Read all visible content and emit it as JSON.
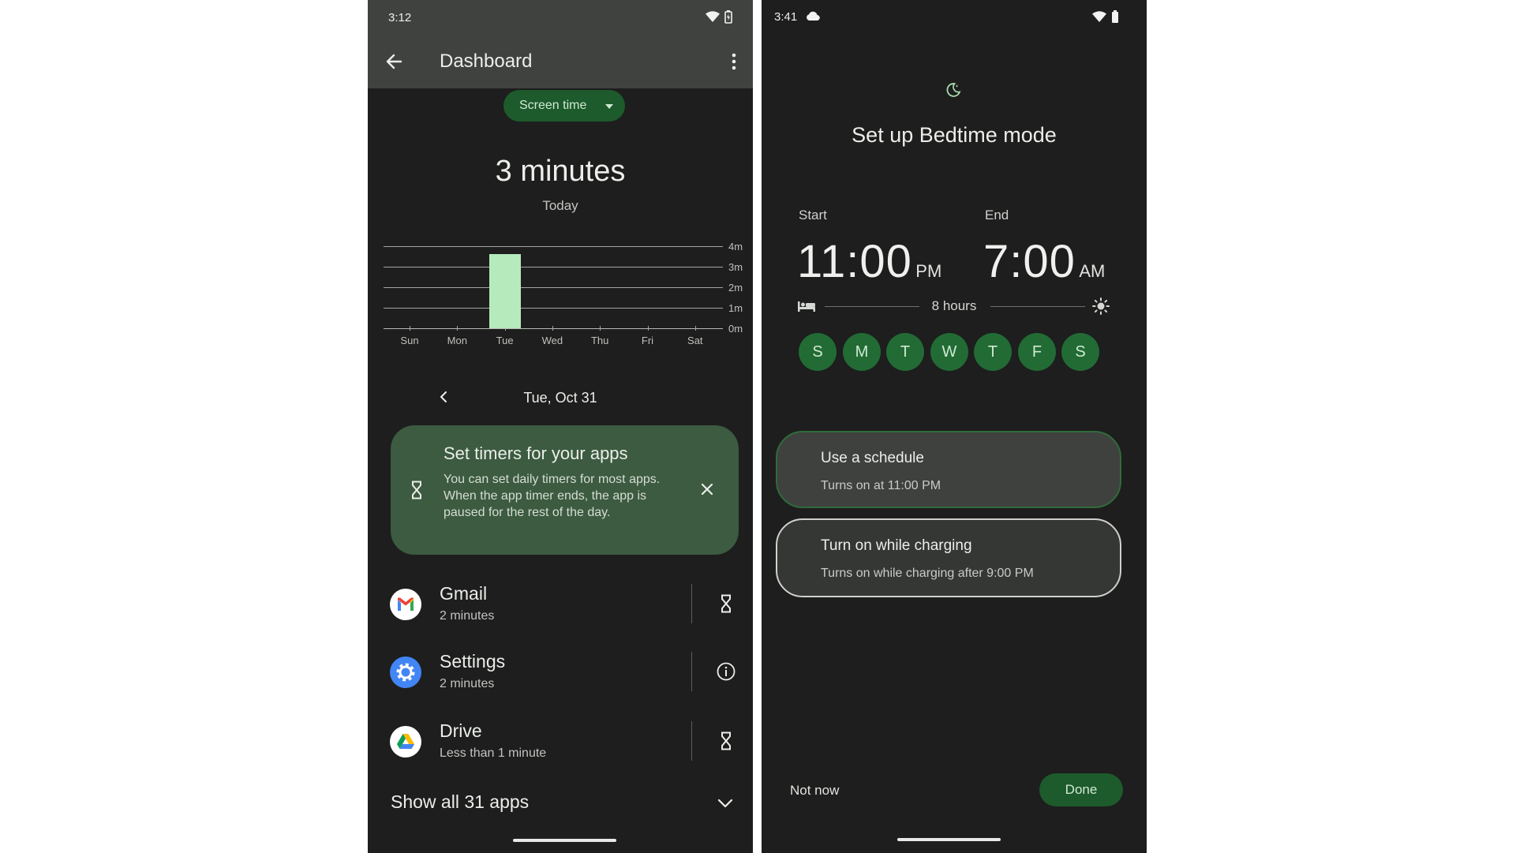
{
  "left": {
    "status": {
      "time": "3:12"
    },
    "appbar": {
      "title": "Dashboard"
    },
    "chip": {
      "label": "Screen time"
    },
    "summary": {
      "total": "3 minutes",
      "period": "Today"
    },
    "chart_data": {
      "type": "bar",
      "categories": [
        "Sun",
        "Mon",
        "Tue",
        "Wed",
        "Thu",
        "Fri",
        "Sat"
      ],
      "values": [
        0,
        0,
        3.6,
        0,
        0,
        0,
        0
      ],
      "y_ticks": [
        "4m",
        "3m",
        "2m",
        "1m",
        "0m"
      ],
      "ylim": [
        0,
        4
      ],
      "grid": true,
      "bar_color": "#b6e9bb"
    },
    "date_nav": {
      "label": "Tue, Oct 31"
    },
    "banner": {
      "title": "Set timers for your apps",
      "body": "You can set daily timers for most apps. When the app timer ends, the app is paused for the rest of the day."
    },
    "apps": [
      {
        "name": "Gmail",
        "usage": "2 minutes",
        "action_icon": "hourglass-icon"
      },
      {
        "name": "Settings",
        "usage": "2 minutes",
        "action_icon": "info-icon"
      },
      {
        "name": "Drive",
        "usage": "Less than 1 minute",
        "action_icon": "hourglass-icon"
      }
    ],
    "show_all": {
      "label": "Show all 31 apps"
    }
  },
  "right": {
    "status": {
      "time": "3:41"
    },
    "title": "Set up Bedtime mode",
    "start": {
      "label": "Start",
      "time": "11:00",
      "ampm": "PM"
    },
    "end": {
      "label": "End",
      "time": "7:00",
      "ampm": "AM"
    },
    "duration": "8 hours",
    "days": [
      "S",
      "M",
      "T",
      "W",
      "T",
      "F",
      "S"
    ],
    "options": [
      {
        "title": "Use a schedule",
        "subtitle": "Turns on at 11:00 PM",
        "selected": true
      },
      {
        "title": "Turn on while charging",
        "subtitle": "Turns on while charging after 9:00 PM",
        "selected": false
      }
    ],
    "buttons": {
      "not_now": "Not now",
      "done": "Done"
    }
  },
  "colors": {
    "background": "#1d1e1d",
    "accent_green": "#226b35",
    "chip_green": "#1d5a2c",
    "banner_green": "#3c5b40",
    "bar_green": "#b6e9bb"
  }
}
